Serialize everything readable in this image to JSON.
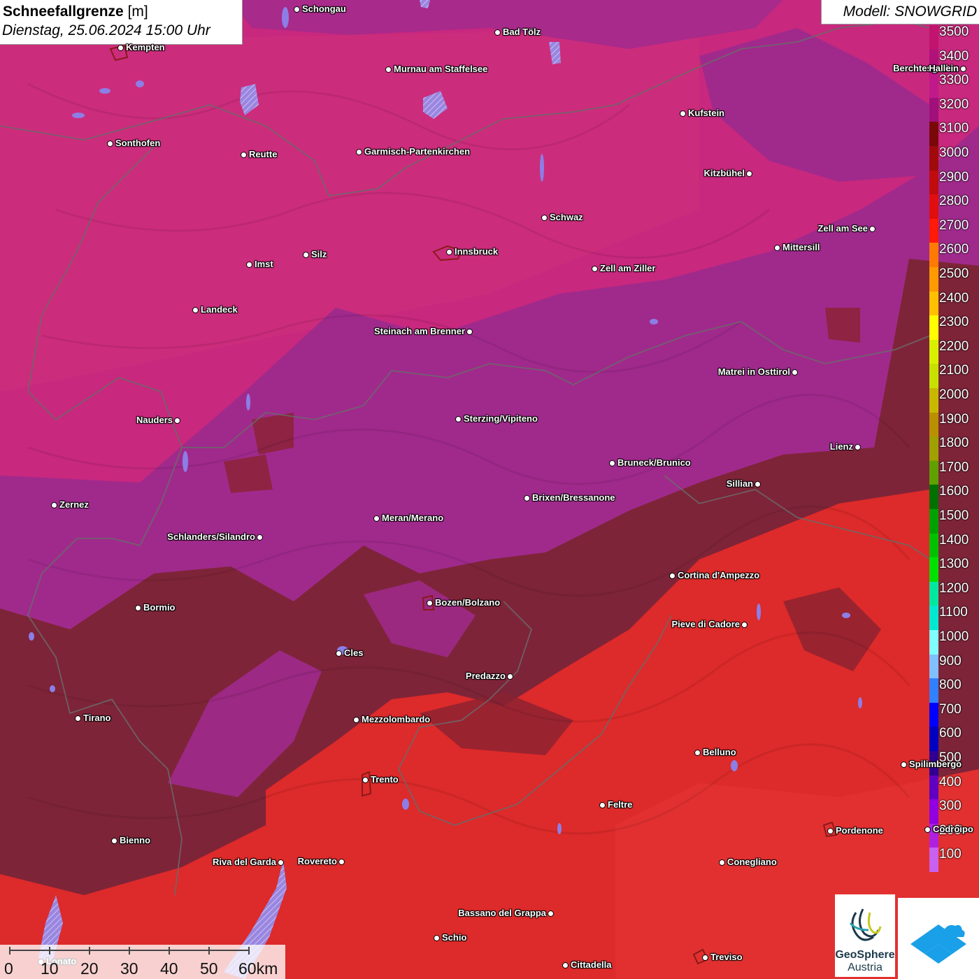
{
  "header": {
    "title_bold": "Schneefallgrenze",
    "title_unit": " [m]",
    "datetime": "Dienstag, 25.06.2024 15:00 Uhr",
    "model": "Modell: SNOWGRID"
  },
  "legend": {
    "levels": [
      {
        "label": "3500",
        "color": "#c0146e"
      },
      {
        "label": "3400",
        "color": "#b0127a"
      },
      {
        "label": "3300",
        "color": "#c01a8a"
      },
      {
        "label": "3200",
        "color": "#a0107a"
      },
      {
        "label": "3100",
        "color": "#7a0808"
      },
      {
        "label": "3000",
        "color": "#a00a0a"
      },
      {
        "label": "2900",
        "color": "#c00c0c"
      },
      {
        "label": "2800",
        "color": "#e00e0e"
      },
      {
        "label": "2700",
        "color": "#ff1a0a"
      },
      {
        "label": "2600",
        "color": "#ff7a00"
      },
      {
        "label": "2500",
        "color": "#ff9a00"
      },
      {
        "label": "2400",
        "color": "#ffc000"
      },
      {
        "label": "2300",
        "color": "#ffff00"
      },
      {
        "label": "2200",
        "color": "#d8f000"
      },
      {
        "label": "2100",
        "color": "#c8e000"
      },
      {
        "label": "2000",
        "color": "#c8b800"
      },
      {
        "label": "1900",
        "color": "#b89000"
      },
      {
        "label": "1800",
        "color": "#a0a000"
      },
      {
        "label": "1700",
        "color": "#60a000"
      },
      {
        "label": "1600",
        "color": "#007000"
      },
      {
        "label": "1500",
        "color": "#00a000"
      },
      {
        "label": "1400",
        "color": "#00c000"
      },
      {
        "label": "1300",
        "color": "#00e000"
      },
      {
        "label": "1200",
        "color": "#00e8a0"
      },
      {
        "label": "1100",
        "color": "#00e8d0"
      },
      {
        "label": "1000",
        "color": "#80ffff"
      },
      {
        "label": "900",
        "color": "#80c0ff"
      },
      {
        "label": "800",
        "color": "#3080ff"
      },
      {
        "label": "700",
        "color": "#0000ff"
      },
      {
        "label": "600",
        "color": "#0000c0"
      },
      {
        "label": "500",
        "color": "#300090"
      },
      {
        "label": "400",
        "color": "#6000c0"
      },
      {
        "label": "300",
        "color": "#9000e0"
      },
      {
        "label": "200",
        "color": "#b020e0"
      },
      {
        "label": "100",
        "color": "#c860f0"
      }
    ]
  },
  "scale": {
    "labels": [
      "0",
      "10",
      "20",
      "30",
      "40",
      "50",
      "60km"
    ]
  },
  "cities": [
    {
      "name": "Schongau",
      "label_side": "right"
    },
    {
      "name": "Bad Tölz",
      "label_side": "right"
    },
    {
      "name": "Kempten",
      "label_side": "right"
    },
    {
      "name": "Murnau am Staffelsee",
      "label_side": "right"
    },
    {
      "name": "Berchtesgaden",
      "label_side": "left"
    },
    {
      "name": "Kufstein",
      "label_side": "right"
    },
    {
      "name": "Sonthofen",
      "label_side": "right"
    },
    {
      "name": "Reutte",
      "label_side": "right"
    },
    {
      "name": "Garmisch-Partenkirchen",
      "label_side": "right"
    },
    {
      "name": "Kitzbühel",
      "label_side": "left"
    },
    {
      "name": "Schwaz",
      "label_side": "right"
    },
    {
      "name": "Zell am See",
      "label_side": "left"
    },
    {
      "name": "Mittersill",
      "label_side": "right"
    },
    {
      "name": "Innsbruck",
      "label_side": "right"
    },
    {
      "name": "Silz",
      "label_side": "right"
    },
    {
      "name": "Imst",
      "label_side": "right"
    },
    {
      "name": "Zell am Ziller",
      "label_side": "right"
    },
    {
      "name": "Landeck",
      "label_side": "right"
    },
    {
      "name": "Steinach am Brenner",
      "label_side": "left"
    },
    {
      "name": "Matrei in Osttirol",
      "label_side": "left"
    },
    {
      "name": "Nauders",
      "label_side": "left"
    },
    {
      "name": "Sterzing/Vipiteno",
      "label_side": "right"
    },
    {
      "name": "Lienz",
      "label_side": "left"
    },
    {
      "name": "Bruneck/Brunico",
      "label_side": "right"
    },
    {
      "name": "Sillian",
      "label_side": "left"
    },
    {
      "name": "Brixen/Bressanone",
      "label_side": "right"
    },
    {
      "name": "Zernez",
      "label_side": "right"
    },
    {
      "name": "Meran/Merano",
      "label_side": "right"
    },
    {
      "name": "Schlanders/Silandro",
      "label_side": "left"
    },
    {
      "name": "Cortina d'Ampezzo",
      "label_side": "right"
    },
    {
      "name": "Bozen/Bolzano",
      "label_side": "right"
    },
    {
      "name": "Bormio",
      "label_side": "right"
    },
    {
      "name": "Pieve di Cadore",
      "label_side": "left"
    },
    {
      "name": "Cles",
      "label_side": "right"
    },
    {
      "name": "Predazzo",
      "label_side": "left"
    },
    {
      "name": "Tirano",
      "label_side": "right"
    },
    {
      "name": "Mezzolombardo",
      "label_side": "right"
    },
    {
      "name": "Belluno",
      "label_side": "right"
    },
    {
      "name": "Spilimbergo",
      "label_side": "right"
    },
    {
      "name": "Trento",
      "label_side": "right"
    },
    {
      "name": "Feltre",
      "label_side": "right"
    },
    {
      "name": "Pordenone",
      "label_side": "right"
    },
    {
      "name": "Bienno",
      "label_side": "right"
    },
    {
      "name": "Riva del Garda",
      "label_side": "left"
    },
    {
      "name": "Rovereto",
      "label_side": "left"
    },
    {
      "name": "Conegliano",
      "label_side": "right"
    },
    {
      "name": "Bassano del Grappa",
      "label_side": "left"
    },
    {
      "name": "Schio",
      "label_side": "right"
    },
    {
      "name": "Treviso",
      "label_side": "right"
    },
    {
      "name": "Cittadella",
      "label_side": "right"
    },
    {
      "name": "Hallein",
      "label_side": "left"
    },
    {
      "name": "Lonato",
      "label_side": "right"
    },
    {
      "name": "Codroipo",
      "label_side": "right"
    }
  ],
  "logos": {
    "geosphere_line1": "GeoSphere",
    "geosphere_line2": "Austria"
  },
  "colors": {
    "north_zone": "#c8287e",
    "mid_zone": "#a02a8a",
    "dark_zone": "#7a2030",
    "south_zone": "#dd2a2a",
    "lake": "#9080e0"
  }
}
